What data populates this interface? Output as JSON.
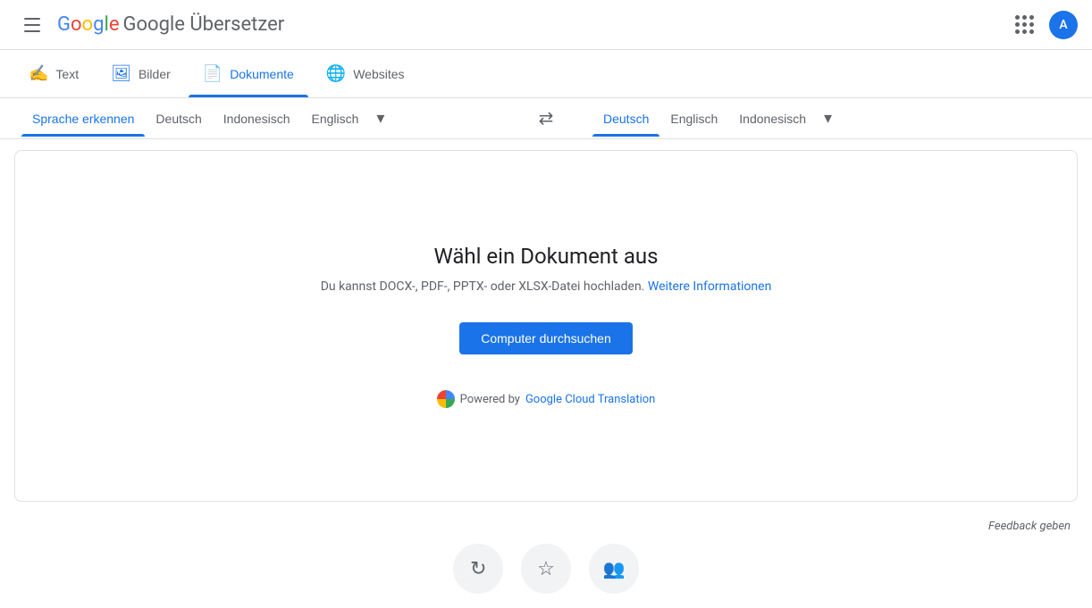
{
  "header": {
    "title": "Google Übersetzer",
    "google_g": "G",
    "avatar_letter": "A",
    "avatar_bg": "#1a73e8"
  },
  "tabs": [
    {
      "id": "text",
      "label": "Text",
      "icon": "✍️",
      "active": false
    },
    {
      "id": "bilder",
      "label": "Bilder",
      "icon": "🖼️",
      "active": false
    },
    {
      "id": "dokumente",
      "label": "Dokumente",
      "icon": "📄",
      "active": true
    },
    {
      "id": "websites",
      "label": "Websites",
      "icon": "🌐",
      "active": false
    }
  ],
  "source_langs": [
    {
      "id": "erkennen",
      "label": "Sprache erkennen",
      "active": true
    },
    {
      "id": "deutsch",
      "label": "Deutsch",
      "active": false
    },
    {
      "id": "indonesisch",
      "label": "Indonesisch",
      "active": false
    },
    {
      "id": "englisch",
      "label": "Englisch",
      "active": false
    }
  ],
  "target_langs": [
    {
      "id": "deutsch",
      "label": "Deutsch",
      "active": true
    },
    {
      "id": "englisch",
      "label": "Englisch",
      "active": false
    },
    {
      "id": "indonesisch",
      "label": "Indonesisch",
      "active": false
    }
  ],
  "more_label": "▾",
  "swap_icon": "⇄",
  "doc_panel": {
    "title": "Wähl ein Dokument aus",
    "subtitle_before": "Du kannst DOCX-, PDF-, PPTX- oder XLSX-Datei hochladen.",
    "subtitle_link_label": "Weitere Informationen",
    "browse_btn_label": "Computer durchsuchen",
    "powered_by_label": "Powered by",
    "powered_by_link": "Google Cloud Translation"
  },
  "feedback_label": "Feedback geben",
  "bottom_icons": [
    {
      "id": "history",
      "icon": "↺",
      "label": "Verlauf"
    },
    {
      "id": "saved",
      "icon": "★",
      "label": "Gespeichert"
    },
    {
      "id": "community",
      "icon": "👥",
      "label": "Community"
    }
  ]
}
